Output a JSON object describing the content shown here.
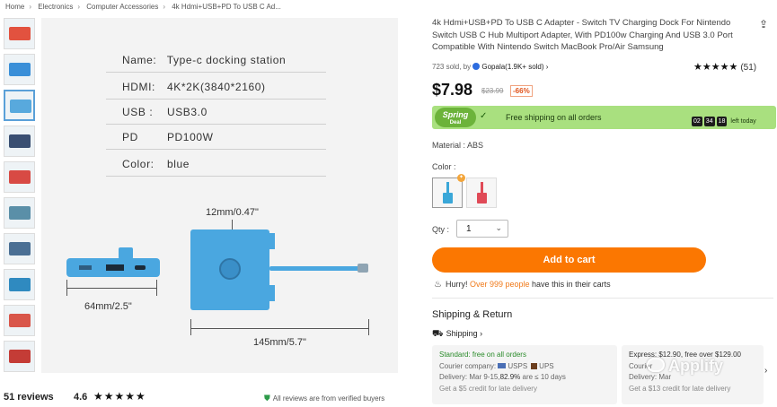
{
  "breadcrumb": [
    "Home",
    "Electronics",
    "Computer Accessories",
    "4k Hdmi+USB+PD To USB C Ad..."
  ],
  "thumbnails": [
    {
      "color": "#e2523f"
    },
    {
      "color": "#3a8fd8"
    },
    {
      "color": "#58a9dd"
    },
    {
      "color": "#3a4f72"
    },
    {
      "color": "#d84a44"
    },
    {
      "color": "#5a8fa8"
    },
    {
      "color": "#4a6f94"
    },
    {
      "color": "#2f8ac0"
    },
    {
      "color": "#d9564a"
    },
    {
      "color": "#c43c36"
    }
  ],
  "product_image": {
    "specs": [
      {
        "k": "Name:",
        "v": "Type-c docking station"
      },
      {
        "k": "HDMI:",
        "v": "4K*2K(3840*2160)"
      },
      {
        "k": "USB :",
        "v": "USB3.0"
      },
      {
        "k": "PD",
        "v": "PD100W"
      },
      {
        "k": "Color:",
        "v": "blue"
      }
    ],
    "dim_width_top": "12mm/0.47\"",
    "dim_left": "64mm/2.5\"",
    "dim_bottom": "145mm/5.7\"",
    "device_color": "#4aa7e0"
  },
  "reviews_bar": {
    "count": "51 reviews",
    "score": "4.6",
    "stars": "★★★★★",
    "verified": "All reviews are from verified buyers"
  },
  "product": {
    "title": "4k Hdmi+USB+PD To USB C Adapter - Switch TV Charging Dock For Nintendo Switch USB C Hub Multiport Adapter, With PD100w Charging And USB 3.0 Port Compatible With Nintendo Switch MacBook Pro/Air Samsung",
    "sold_prefix": "723 sold, by",
    "store": "Gopala(1.9K+ sold) ›",
    "stars": "★★★★★",
    "rating_count": "(51)",
    "price": "$7.98",
    "old_price": "$23.99",
    "discount": "-66%"
  },
  "promo": {
    "badge_top": "Spring",
    "badge_bottom": "Deal",
    "shipping": "Free shipping on all orders",
    "countdown": [
      "02",
      "34",
      "18"
    ],
    "countdown_suffix": "left today",
    "bg": "#a9e07f"
  },
  "material": "Material : ABS",
  "color_label": "Color :",
  "swatches": [
    {
      "color": "#3aa7d8"
    },
    {
      "color": "#e04a57"
    }
  ],
  "qty": {
    "label": "Qty :",
    "value": "1"
  },
  "cart_button": "Add to cart",
  "hurry": {
    "lead": "Hurry!",
    "hot": "Over 999 people",
    "tail": "have this in their carts"
  },
  "shipping_section": {
    "title": "Shipping & Return",
    "link": "Shipping ›",
    "cards": [
      {
        "head": "Standard: free on all orders",
        "courier_label": "Courier company:",
        "couriers": [
          "USPS",
          "UPS"
        ],
        "delivery_pre": "Delivery: Mar 9-15,",
        "delivery_pct": "82.9%",
        "delivery_post": "are ≤ 10 days",
        "credit": "Get a $5 credit for late delivery"
      },
      {
        "head": "Express: $12.90, free over $129.00",
        "courier_label": "Courier",
        "couriers": [],
        "delivery_pre": "Delivery: Mar",
        "delivery_pct": "",
        "delivery_post": "",
        "credit": "Get a $13 credit for late delivery"
      }
    ]
  },
  "watermark": "Applify"
}
